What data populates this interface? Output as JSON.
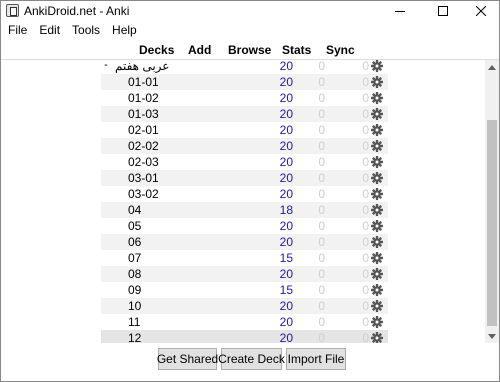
{
  "window": {
    "title": "AnkiDroid.net - Anki"
  },
  "menu": [
    {
      "label": "File"
    },
    {
      "label": "Edit"
    },
    {
      "label": "Tools"
    },
    {
      "label": "Help"
    }
  ],
  "toolbar": {
    "decks": "Decks",
    "add": "Add",
    "browse": "Browse",
    "stats": "Stats",
    "sync": "Sync"
  },
  "decks": [
    {
      "collapse": "-",
      "name": "عربی هفتم",
      "due": "20",
      "learn": "0",
      "new": "0",
      "rtl": true
    },
    {
      "name": "01-01",
      "due": "20",
      "learn": "0",
      "new": "0"
    },
    {
      "name": "01-02",
      "due": "20",
      "learn": "0",
      "new": "0"
    },
    {
      "name": "01-03",
      "due": "20",
      "learn": "0",
      "new": "0"
    },
    {
      "name": "02-01",
      "due": "20",
      "learn": "0",
      "new": "0"
    },
    {
      "name": "02-02",
      "due": "20",
      "learn": "0",
      "new": "0"
    },
    {
      "name": "02-03",
      "due": "20",
      "learn": "0",
      "new": "0"
    },
    {
      "name": "03-01",
      "due": "20",
      "learn": "0",
      "new": "0"
    },
    {
      "name": "03-02",
      "due": "20",
      "learn": "0",
      "new": "0"
    },
    {
      "name": "04",
      "due": "18",
      "learn": "0",
      "new": "0"
    },
    {
      "name": "05",
      "due": "20",
      "learn": "0",
      "new": "0"
    },
    {
      "name": "06",
      "due": "20",
      "learn": "0",
      "new": "0"
    },
    {
      "name": "07",
      "due": "15",
      "learn": "0",
      "new": "0"
    },
    {
      "name": "08",
      "due": "20",
      "learn": "0",
      "new": "0"
    },
    {
      "name": "09",
      "due": "15",
      "learn": "0",
      "new": "0"
    },
    {
      "name": "10",
      "due": "20",
      "learn": "0",
      "new": "0"
    },
    {
      "name": "11",
      "due": "20",
      "learn": "0",
      "new": "0"
    },
    {
      "name": "12",
      "due": "20",
      "learn": "0",
      "new": "0"
    }
  ],
  "buttons": {
    "get_shared": "Get Shared",
    "create_deck": "Create Deck",
    "import_file": "Import File"
  },
  "colors": {
    "due_count": "#1a1ab0",
    "zero_count": "#cfcfcf",
    "current_row": "#e5e5e5"
  }
}
